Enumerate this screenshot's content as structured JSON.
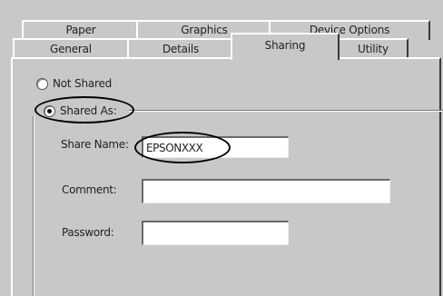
{
  "tabs": {
    "row_back": [
      "Paper",
      "Graphics",
      "Device Options"
    ],
    "row_front": [
      "General",
      "Details",
      "Sharing",
      "Utility"
    ],
    "selected": "Sharing"
  },
  "sharing": {
    "not_shared_label": "Not Shared",
    "shared_as_label": "Shared As:",
    "selected_option": "Shared As:",
    "share_name_label": "Share Name:",
    "share_name_value": "EPSONXXX",
    "comment_label": "Comment:",
    "comment_value": "",
    "password_label": "Password:",
    "password_value": ""
  }
}
